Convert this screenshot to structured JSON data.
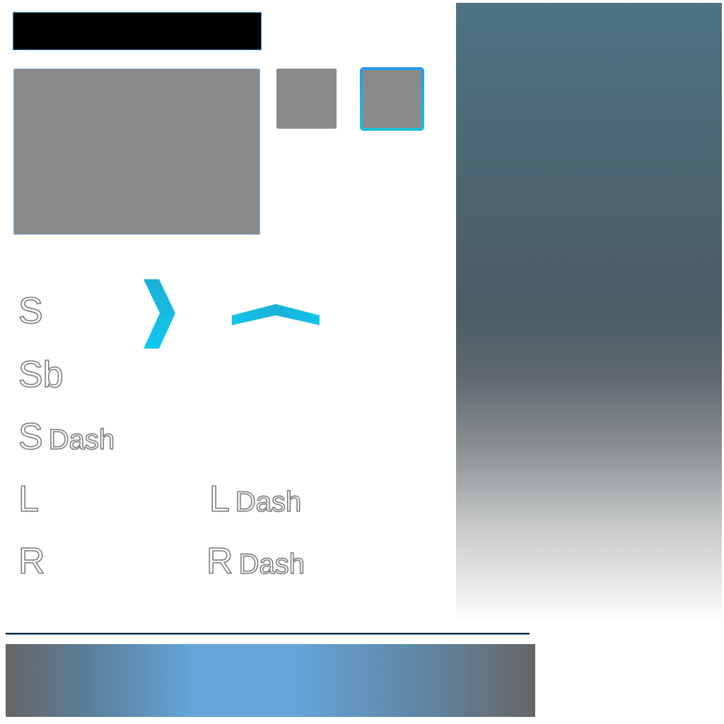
{
  "labels": {
    "s": "S",
    "sb": "Sb",
    "s_dash_letter": "S",
    "s_dash_word": "Dash",
    "l": "L",
    "r": "R",
    "l_dash_letter": "L",
    "l_dash_word": "Dash",
    "r_dash_letter": "R",
    "r_dash_word": "Dash"
  },
  "icons": {
    "chevron_right": "chevron-right-icon",
    "chevron_up": "chevron-up-icon"
  },
  "colors": {
    "accent": "#18b8e0",
    "accent_blue": "#2a98e8",
    "placeholder_gray": "#8a8a8a",
    "title_bar": "#000000"
  }
}
